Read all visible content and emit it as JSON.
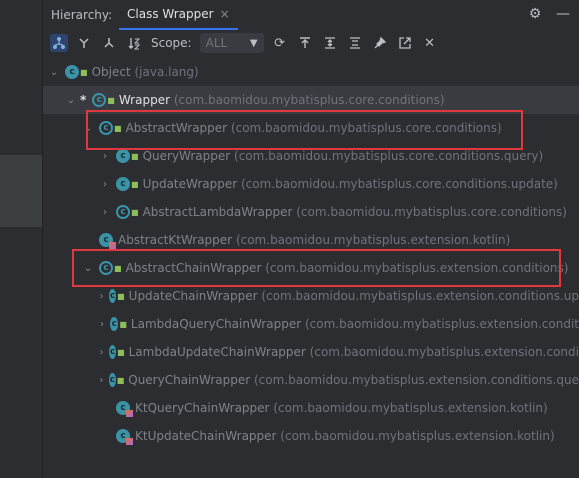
{
  "header": {
    "label": "Hierarchy:",
    "tab_label": "Class Wrapper",
    "tab_close": "×",
    "settings_icon": "gear-icon",
    "minimize_icon": "minus-icon"
  },
  "toolbar": {
    "scope_label": "Scope:",
    "scope_value": "ALL"
  },
  "tree": [
    {
      "indent": 0,
      "expanded": true,
      "name": "Object",
      "pkg": " (java.lang)",
      "icon": "class"
    },
    {
      "indent": 1,
      "expanded": true,
      "star": "*",
      "name": "Wrapper",
      "pkg": " (com.baomidou.mybatisplus.core.conditions)",
      "icon": "abstract",
      "selected": true
    },
    {
      "indent": 2,
      "expanded": true,
      "name": "AbstractWrapper",
      "pkg": " (com.baomidou.mybatisplus.core.conditions)",
      "icon": "abstract"
    },
    {
      "indent": 3,
      "expanded": false,
      "name": "QueryWrapper",
      "pkg": " (com.baomidou.mybatisplus.core.conditions.query)",
      "icon": "class"
    },
    {
      "indent": 3,
      "expanded": false,
      "name": "UpdateWrapper",
      "pkg": " (com.baomidou.mybatisplus.core.conditions.update)",
      "icon": "class"
    },
    {
      "indent": 3,
      "expanded": false,
      "name": "AbstractLambdaWrapper",
      "pkg": " (com.baomidou.mybatisplus.core.conditions)",
      "icon": "abstract"
    },
    {
      "indent": 2,
      "expanded": false,
      "leaf": true,
      "name": "AbstractKtWrapper",
      "pkg": " (com.baomidou.mybatisplus.extension.kotlin)",
      "icon": "kt"
    },
    {
      "indent": 2,
      "expanded": true,
      "name": "AbstractChainWrapper",
      "pkg": " (com.baomidou.mybatisplus.extension.conditions)",
      "icon": "abstract"
    },
    {
      "indent": 3,
      "expanded": false,
      "name": "UpdateChainWrapper",
      "pkg": " (com.baomidou.mybatisplus.extension.conditions.up",
      "icon": "class"
    },
    {
      "indent": 3,
      "expanded": false,
      "name": "LambdaQueryChainWrapper",
      "pkg": " (com.baomidou.mybatisplus.extension.condit",
      "icon": "class"
    },
    {
      "indent": 3,
      "expanded": false,
      "name": "LambdaUpdateChainWrapper",
      "pkg": " (com.baomidou.mybatisplus.extension.condi",
      "icon": "class"
    },
    {
      "indent": 3,
      "expanded": false,
      "name": "QueryChainWrapper",
      "pkg": " (com.baomidou.mybatisplus.extension.conditions.que",
      "icon": "class"
    },
    {
      "indent": 3,
      "expanded": false,
      "leaf": true,
      "name": "KtQueryChainWrapper",
      "pkg": " (com.baomidou.mybatisplus.extension.kotlin)",
      "icon": "kt"
    },
    {
      "indent": 3,
      "expanded": false,
      "leaf": true,
      "name": "KtUpdateChainWrapper",
      "pkg": " (com.baomidou.mybatisplus.extension.kotlin)",
      "icon": "kt"
    }
  ],
  "colors": {
    "highlight": "#e0383e",
    "accent": "#3574f0",
    "class_icon": "#3b93a8"
  }
}
